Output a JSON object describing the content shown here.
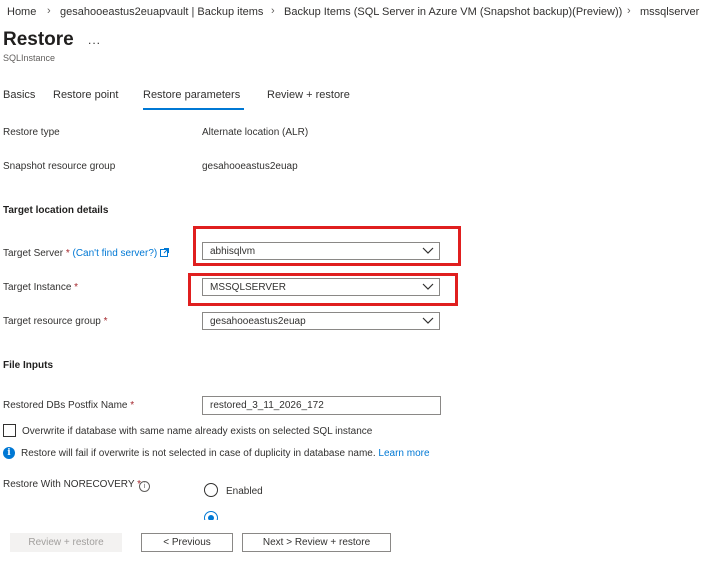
{
  "breadcrumb": [
    {
      "label": "Home"
    },
    {
      "label": "gesahooeastus2euapvault | Backup items"
    },
    {
      "label": "Backup Items (SQL Server in Azure VM (Snapshot backup)(Preview))"
    },
    {
      "label": "mssqlserver"
    }
  ],
  "breadcrumb_separator": "›",
  "page": {
    "title": "Restore",
    "more_label": "...",
    "subtitle": "SQLInstance"
  },
  "tabs": [
    {
      "label": "Basics"
    },
    {
      "label": "Restore point"
    },
    {
      "label": "Restore parameters",
      "active": true
    },
    {
      "label": "Review + restore"
    }
  ],
  "fields": {
    "restore_type": {
      "label": "Restore type",
      "value": "Alternate location (ALR)"
    },
    "snapshot_rg": {
      "label": "Snapshot resource group",
      "value": "gesahooeastus2euap"
    }
  },
  "target": {
    "section_title": "Target location details",
    "server": {
      "label": "Target Server",
      "req": "*",
      "link": "(Can't find server?)",
      "value": "abhisqlvm"
    },
    "instance": {
      "label": "Target Instance",
      "req": "*",
      "value": "MSSQLSERVER"
    },
    "rg": {
      "label": "Target resource group",
      "req": "*",
      "value": "gesahooeastus2euap"
    }
  },
  "file_inputs": {
    "section_title": "File Inputs",
    "postfix": {
      "label": "Restored DBs Postfix Name",
      "req": "*",
      "value": "restored_3_11_2026_172"
    },
    "overwrite_label": "Overwrite if database with same name already exists on selected SQL instance",
    "info_text": "Restore will fail if overwrite is not selected in case of duplicity in database name.",
    "learn_more": "Learn more",
    "norecovery": {
      "label": "Restore With NORECOVERY",
      "req": "*",
      "options": [
        "Enabled"
      ]
    }
  },
  "footer": {
    "review_label": "Review + restore",
    "previous_label": "< Previous",
    "next_label": "Next > Review + restore"
  },
  "colors": {
    "accent": "#0078d4",
    "highlight": "#e01f1f",
    "required": "#a4262c"
  }
}
